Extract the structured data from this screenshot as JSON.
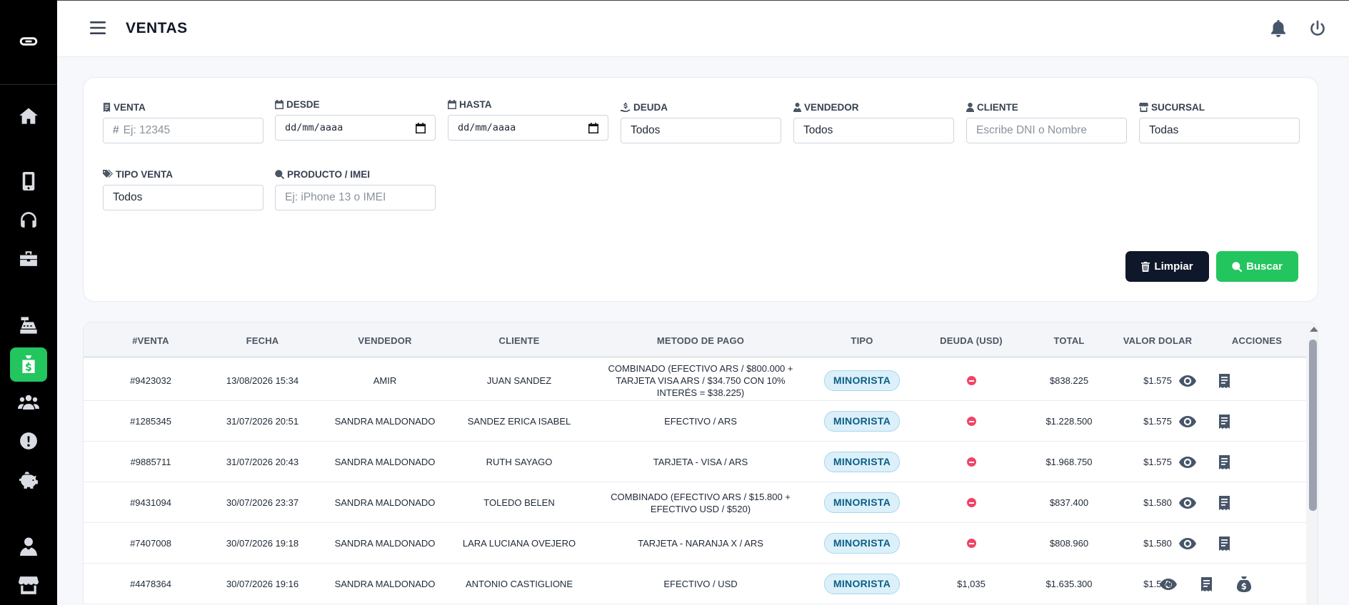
{
  "header": {
    "title": "VENTAS"
  },
  "filters": {
    "venta": {
      "label": "VENTA",
      "placeholder": "Ej: 12345"
    },
    "desde": {
      "label": "DESDE",
      "value": "dd/mm/aaaa"
    },
    "hasta": {
      "label": "HASTA",
      "value": "dd/mm/aaaa"
    },
    "deuda": {
      "label": "DEUDA",
      "value": "Todos"
    },
    "vendedor": {
      "label": "VENDEDOR",
      "value": "Todos"
    },
    "cliente": {
      "label": "CLIENTE",
      "placeholder": "Escribe DNI o Nombre"
    },
    "sucursal": {
      "label": "SUCURSAL",
      "value": "Todas"
    },
    "tipo_venta": {
      "label": "TIPO VENTA",
      "value": "Todos"
    },
    "producto": {
      "label": "PRODUCTO / IMEI",
      "placeholder": "Ej: iPhone 13 o IMEI"
    },
    "clear_label": "Limpiar",
    "search_label": "Buscar"
  },
  "table": {
    "headers": {
      "venta": "#VENTA",
      "fecha": "FECHA",
      "vendedor": "VENDEDOR",
      "cliente": "CLIENTE",
      "metodo": "METODO DE PAGO",
      "tipo": "TIPO",
      "deuda": "DEUDA (USD)",
      "total": "TOTAL",
      "dolar": "VALOR DOLAR",
      "acciones": "ACCIONES"
    },
    "rows": [
      {
        "venta": "#9423032",
        "fecha": "13/08/2026 15:34",
        "vendedor": "AMIR",
        "cliente": "JUAN SANDEZ",
        "metodo": "COMBINADO (EFECTIVO ARS / $800.000 + TARJETA VISA ARS / $34.750 CON 10% INTERÉS = $38.225)",
        "tipo": "MINORISTA",
        "deuda": "",
        "total": "$838.225",
        "dolar": "$1.575"
      },
      {
        "venta": "#1285345",
        "fecha": "31/07/2026 20:51",
        "vendedor": "SANDRA MALDONADO",
        "cliente": "SANDEZ ERICA ISABEL",
        "metodo": "EFECTIVO / ARS",
        "tipo": "MINORISTA",
        "deuda": "",
        "total": "$1.228.500",
        "dolar": "$1.575"
      },
      {
        "venta": "#9885711",
        "fecha": "31/07/2026 20:43",
        "vendedor": "SANDRA MALDONADO",
        "cliente": "RUTH SAYAGO",
        "metodo": "TARJETA - VISA / ARS",
        "tipo": "MINORISTA",
        "deuda": "",
        "total": "$1.968.750",
        "dolar": "$1.575"
      },
      {
        "venta": "#9431094",
        "fecha": "30/07/2026 23:37",
        "vendedor": "SANDRA MALDONADO",
        "cliente": "TOLEDO BELEN",
        "metodo": "COMBINADO (EFECTIVO ARS / $15.800 + EFECTIVO USD / $520)",
        "tipo": "MINORISTA",
        "deuda": "",
        "total": "$837.400",
        "dolar": "$1.580"
      },
      {
        "venta": "#7407008",
        "fecha": "30/07/2026 19:18",
        "vendedor": "SANDRA MALDONADO",
        "cliente": "LARA LUCIANA OVEJERO",
        "metodo": "TARJETA - NARANJA X / ARS",
        "tipo": "MINORISTA",
        "deuda": "",
        "total": "$808.960",
        "dolar": "$1.580"
      },
      {
        "venta": "#4478364",
        "fecha": "30/07/2026 19:16",
        "vendedor": "SANDRA MALDONADO",
        "cliente": "ANTONIO CASTIGLIONE",
        "metodo": "EFECTIVO / USD",
        "tipo": "MINORISTA",
        "deuda": "$1,035",
        "total": "$1.635.300",
        "dolar": "$1.580"
      }
    ]
  },
  "icons": {
    "sidebar": [
      "logo-icon",
      "home-icon",
      "phone-icon",
      "headphones-icon",
      "toolbox-icon",
      "cash-register-icon",
      "money-bag-icon",
      "users-icon",
      "alert-icon",
      "piggy-bank-icon",
      "user-tie-icon",
      "store-icon"
    ],
    "header": [
      "bell-icon",
      "power-icon"
    ]
  },
  "colors": {
    "accent": "#22c55e",
    "dark": "#0f172a",
    "badge_bg": "#dcf0fa",
    "badge_text": "#0b5e86",
    "debt_dot": "#ef4466"
  }
}
